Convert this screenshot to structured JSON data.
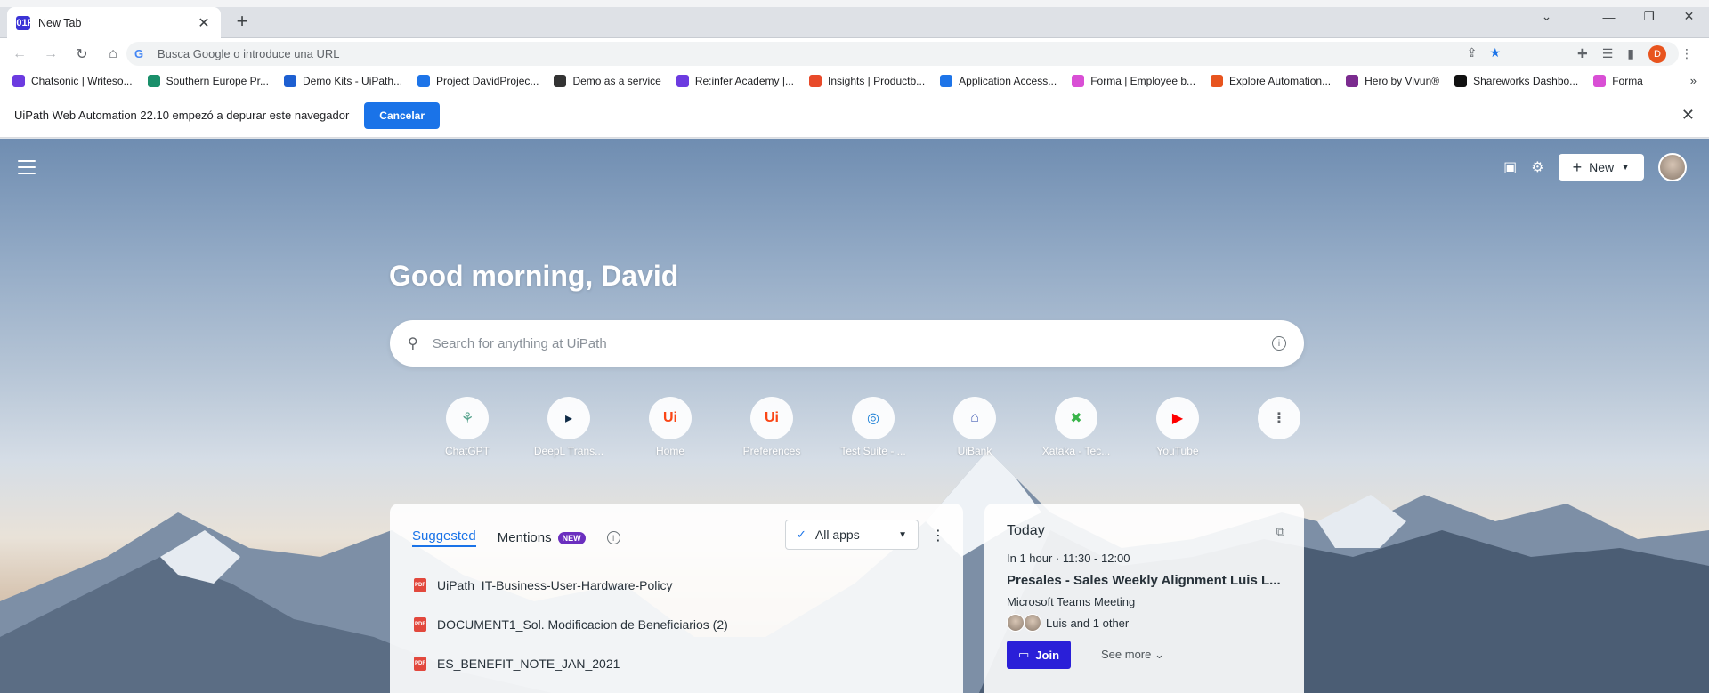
{
  "browser": {
    "tab_title": "New Tab",
    "tab_favicon": "uipath-assistant-icon",
    "omnibox_placeholder": "Busca Google o introduce una URL",
    "profile_initial": "D"
  },
  "bookmarks": [
    {
      "label": "Chatsonic | Writeso...",
      "color": "#6c3be0"
    },
    {
      "label": "Southern Europe Pr...",
      "color": "#1a8f6a"
    },
    {
      "label": "Demo Kits - UiPath...",
      "color": "#1d5fd1"
    },
    {
      "label": "Project DavidProjec...",
      "color": "#1d74e8"
    },
    {
      "label": "Demo as a service",
      "color": "#333333"
    },
    {
      "label": "Re:infer Academy |...",
      "color": "#6c3be0"
    },
    {
      "label": "Insights | Productb...",
      "color": "#e84a2a"
    },
    {
      "label": "Application Access...",
      "color": "#1d74e8"
    },
    {
      "label": "Forma | Employee b...",
      "color": "#d94fd5"
    },
    {
      "label": "Explore Automation...",
      "color": "#e8541e"
    },
    {
      "label": "Hero by Vivun®",
      "color": "#7b2b8f"
    },
    {
      "label": "Shareworks Dashbo...",
      "color": "#111111"
    },
    {
      "label": "Forma",
      "color": "#d94fd5"
    }
  ],
  "infobar": {
    "message": "UiPath Web Automation 22.10 empezó a depurar este navegador",
    "cancel_label": "Cancelar"
  },
  "page": {
    "new_label": "New",
    "greeting": "Good morning, David",
    "search_placeholder": "Search for anything at UiPath",
    "shortcuts": [
      {
        "label": "ChatGPT",
        "glyph": "⚘",
        "color": "#5aa58f"
      },
      {
        "label": "DeepL Trans...",
        "glyph": "▸",
        "color": "#0f2b46"
      },
      {
        "label": "Home",
        "glyph": "Ui",
        "color": "#fa4616"
      },
      {
        "label": "Preferences",
        "glyph": "Ui",
        "color": "#fa4616"
      },
      {
        "label": "Test Suite - ...",
        "glyph": "◎",
        "color": "#1c80d6"
      },
      {
        "label": "UiBank",
        "glyph": "⌂",
        "color": "#4b64b8"
      },
      {
        "label": "Xataka - Tec...",
        "glyph": "✖",
        "color": "#39b54a"
      },
      {
        "label": "YouTube",
        "glyph": "▶",
        "color": "#ff0000"
      }
    ],
    "suggested": {
      "tab_suggested": "Suggested",
      "tab_mentions": "Mentions",
      "badge": "NEW",
      "filter_label": "All apps",
      "docs": [
        {
          "name": "UiPath_IT-Business-User-Hardware-Policy",
          "icon": "pdf-icon"
        },
        {
          "name": "DOCUMENT1_Sol. Modificacion de Beneficiarios (2)",
          "icon": "pdf-icon"
        },
        {
          "name": "ES_BENEFIT_NOTE_JAN_2021",
          "icon": "pdf-icon"
        }
      ]
    },
    "calendar": {
      "heading": "Today",
      "time": "In 1 hour · 11:30 - 12:00",
      "title": "Presales - Sales Weekly Alignment Luis L...",
      "subtitle": "Microsoft Teams Meeting",
      "attendees": "Luis and 1 other",
      "join_label": "Join",
      "more_label": "See more"
    }
  }
}
